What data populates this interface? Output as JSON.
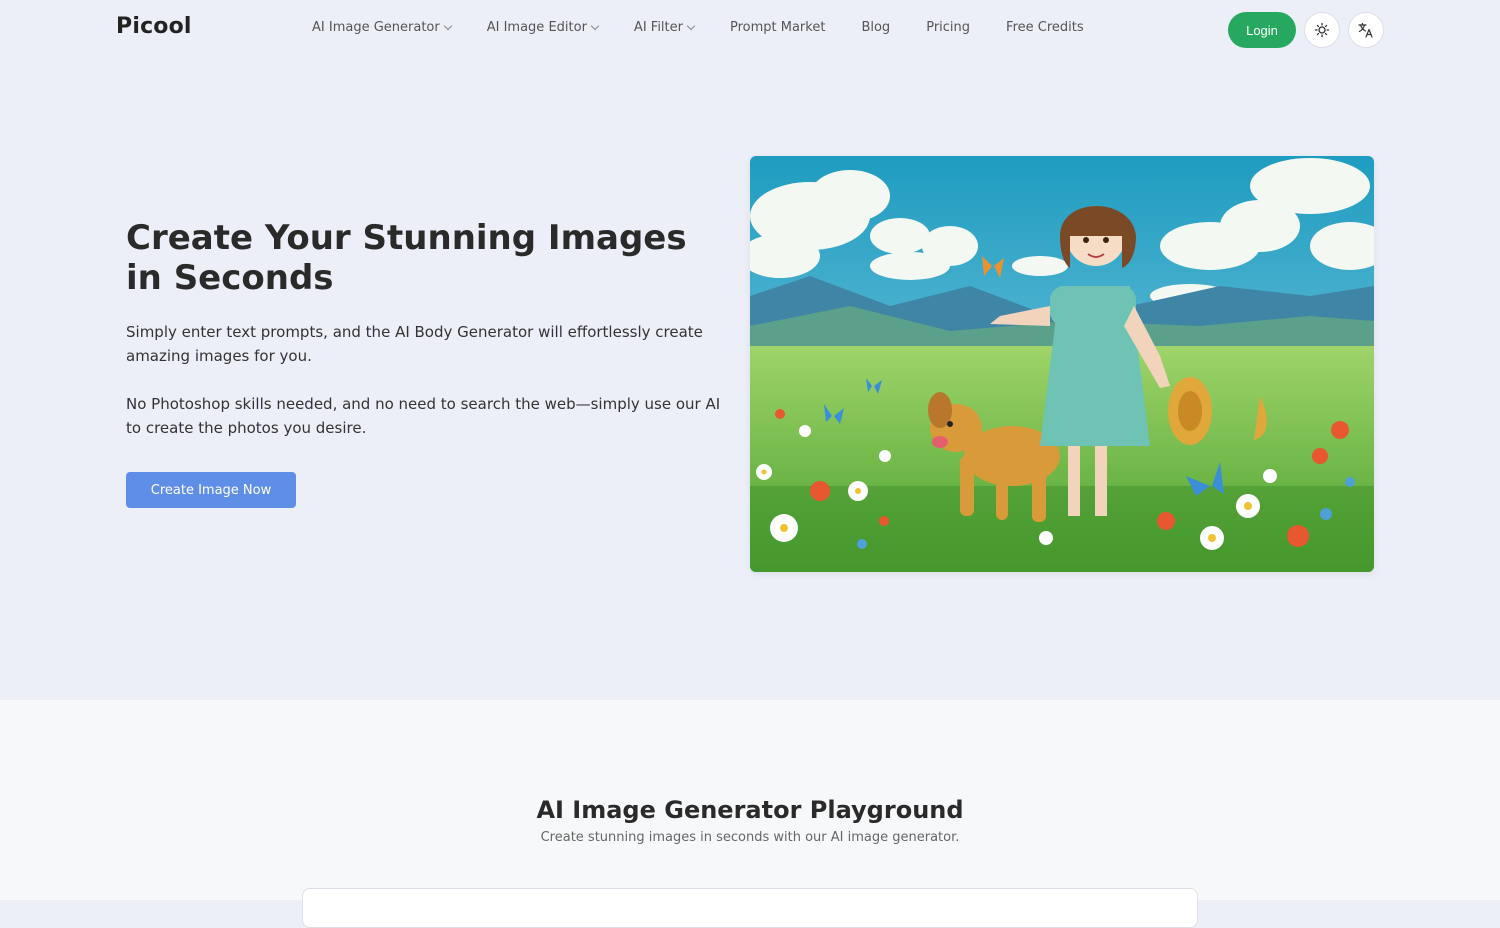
{
  "brand": {
    "logo": "Picool",
    "accent": "#27a860",
    "cta_color": "#5f8ee6"
  },
  "nav": {
    "items": [
      {
        "label": "AI Image Generator",
        "dropdown": true
      },
      {
        "label": "AI Image Editor",
        "dropdown": true
      },
      {
        "label": "AI Filter",
        "dropdown": true
      },
      {
        "label": "Prompt Market",
        "dropdown": false
      },
      {
        "label": "Blog",
        "dropdown": false
      },
      {
        "label": "Pricing",
        "dropdown": false
      },
      {
        "label": "Free Credits",
        "dropdown": false
      }
    ],
    "login_label": "Login",
    "theme_icon": "sun-icon",
    "language_icon": "translate-icon"
  },
  "hero": {
    "title": "Create Your Stunning Images in Seconds",
    "paragraph1": "Simply enter text prompts, and the AI Body Generator will effortlessly create amazing images for you.",
    "paragraph2": "No Photoshop skills needed, and no need to search the web—simply use our AI to create the photos you desire.",
    "cta_label": "Create Image Now"
  },
  "playground": {
    "title": "AI Image Generator Playground",
    "subtitle": "Create stunning images in seconds with our AI image generator."
  }
}
